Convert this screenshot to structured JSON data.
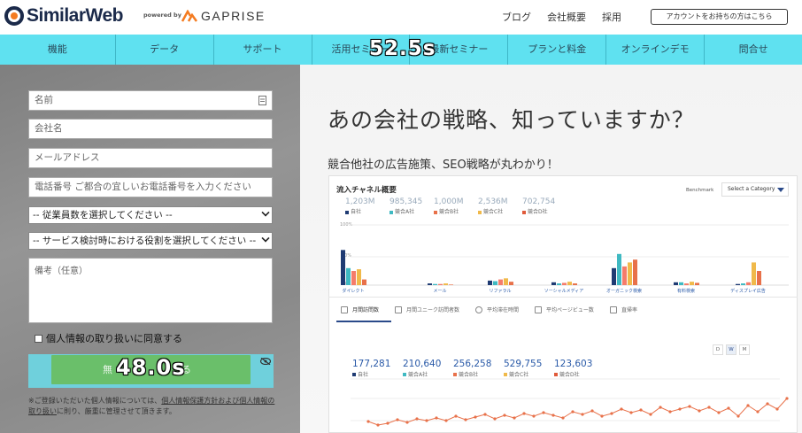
{
  "brand": {
    "name": "SimilarWeb",
    "powered_by": "powered by",
    "partner": "GAPRISE"
  },
  "top_links": [
    "ブログ",
    "会社概要",
    "採用"
  ],
  "account_button": "アカウントをお持ちの方はこちら",
  "nav": [
    "機能",
    "データ",
    "サポート",
    "活用セミナー",
    "最新セミナー",
    "プランと料金",
    "オンラインデモ",
    "問合せ"
  ],
  "timer_overlay_top": "52.5s",
  "form": {
    "name_placeholder": "名前",
    "company_placeholder": "会社名",
    "email_placeholder": "メールアドレス",
    "phone_placeholder": "電話番号 ご都合の宜しいお電話番号を入力ください",
    "employees_select": "-- 従業員数を選択してください --",
    "role_select": "-- サービス検討時における役割を選択してください --",
    "notes_placeholder": "備考（任意）",
    "consent_label": "個人情報の取り扱いに同意する",
    "submit_left": "無",
    "submit_right": "る",
    "timer_overlay_button": "48.0s",
    "note_line1": "※ご登録いただいた個人情報については、",
    "note_link": "個人情報保護方針および個人情報の取り扱い",
    "note_line2": "に則り、厳重に管理させて頂きます。"
  },
  "hero": {
    "title": "あの会社の戦略、知っていますか？",
    "subtitle": "競合他社の広告施策、SEO戦略が丸わかり！"
  },
  "dashboard": {
    "title": "流入チャネル概要",
    "benchmark": "Benchmark",
    "category_select": "Select a Category",
    "top_stats": [
      {
        "value": "1,203M",
        "label": "自社"
      },
      {
        "value": "985,345",
        "label": "競合A社"
      },
      {
        "value": "1,000M",
        "label": "競合B社"
      },
      {
        "value": "2,536M",
        "label": "競合C社"
      },
      {
        "value": "702,754",
        "label": "競合D社"
      }
    ],
    "y_ticks": [
      "100%",
      "50%",
      "0%"
    ],
    "channels": [
      "ダイレクト",
      "メール",
      "リファラル",
      "ソーシャルメディア",
      "オーガニック検索",
      "有料検索",
      "ディスプレイ広告"
    ],
    "tabs": [
      "月間訪問数",
      "月間ユニーク訪問者数",
      "平均滞在時間",
      "平均ページビュー数",
      "直帰率"
    ],
    "granularity": [
      "D",
      "W",
      "M"
    ],
    "bottom_stats": [
      {
        "value": "177,281",
        "label": "自社"
      },
      {
        "value": "210,640",
        "label": "競合A社"
      },
      {
        "value": "256,258",
        "label": "競合B社"
      },
      {
        "value": "529,755",
        "label": "競合C社"
      },
      {
        "value": "123,603",
        "label": "競合D社"
      }
    ],
    "series_colors": [
      "#1f3b73",
      "#3fb9c2",
      "#e8714a",
      "#f0b94a",
      "#e05a3a"
    ]
  }
}
